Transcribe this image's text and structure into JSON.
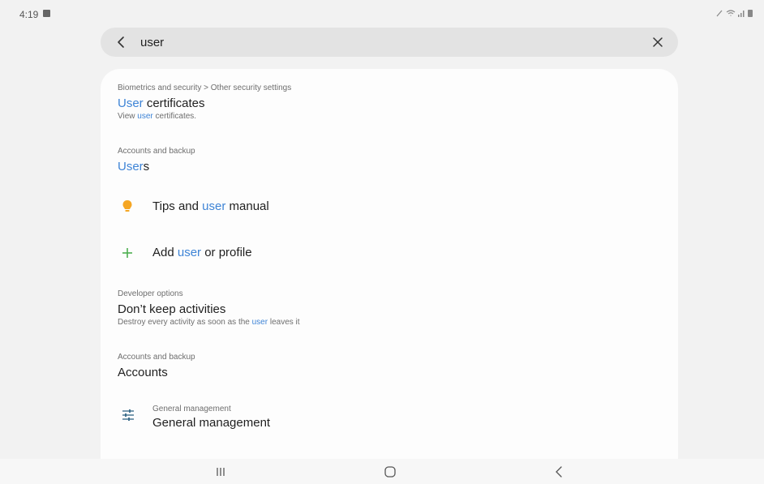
{
  "status_bar": {
    "time": "4:19"
  },
  "search": {
    "query": "user"
  },
  "results": [
    {
      "crumb": "Biometrics and security > Other security settings",
      "title_hl": "User",
      "title_rest": " certificates",
      "sub_pre": "View ",
      "sub_hl": "user",
      "sub_post": " certificates."
    },
    {
      "crumb": "Accounts and backup",
      "title_hl": "User",
      "title_rest": "s"
    },
    {
      "icon": "lightbulb-icon",
      "title_pre": "Tips and ",
      "title_hl": "user",
      "title_post": " manual"
    },
    {
      "icon": "plus-icon",
      "title_pre": "Add ",
      "title_hl": "user",
      "title_post": " or profile"
    },
    {
      "crumb": "Developer options",
      "title": "Don’t keep activities",
      "sub_pre": "Destroy every activity as soon as the ",
      "sub_hl": "user",
      "sub_post": " leaves it"
    },
    {
      "crumb": "Accounts and backup",
      "title": "Accounts"
    },
    {
      "icon": "sliders-icon",
      "crumb": "General management",
      "title": "General management"
    }
  ],
  "colors": {
    "highlight": "#3e84d6",
    "bulb": "#f5a623",
    "plus": "#4caf50",
    "sliders": "#3d6e8c"
  }
}
